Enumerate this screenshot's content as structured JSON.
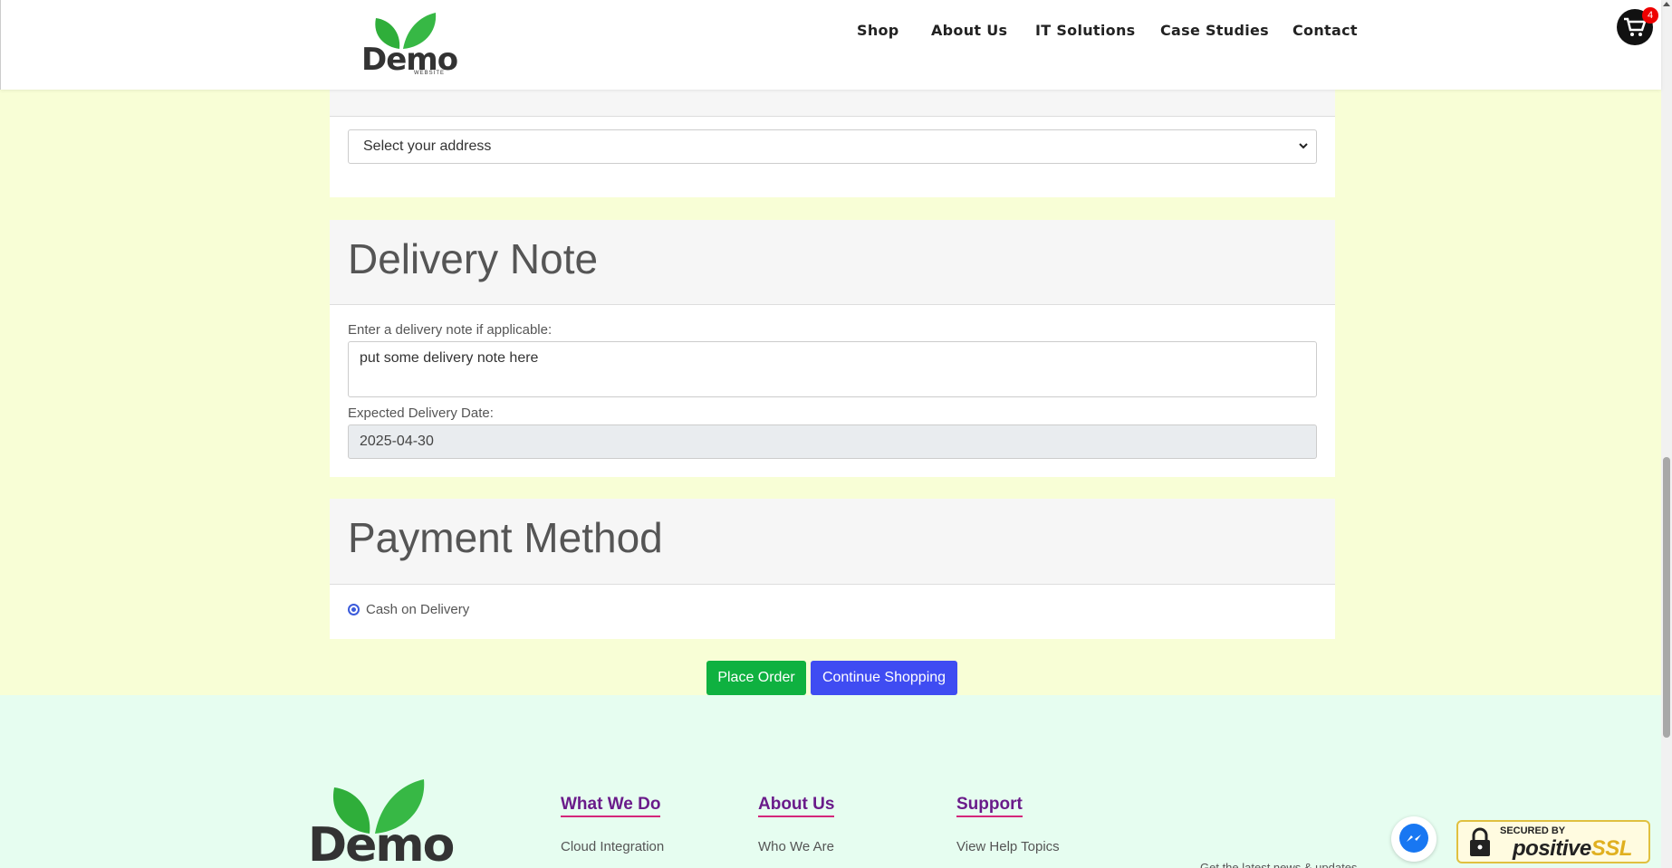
{
  "header": {
    "logo_text": "Demo",
    "logo_sub": "WEBSITE",
    "nav": [
      "Shop",
      "About Us",
      "IT Solutions",
      "Case Studies",
      "Contact"
    ],
    "cart_count": "4"
  },
  "address": {
    "select_value": "Select your address"
  },
  "delivery": {
    "title": "Delivery Note",
    "note_label": "Enter a delivery note if applicable:",
    "note_value": "put some delivery note here",
    "date_label": "Expected Delivery Date:",
    "date_value": "2025-04-30"
  },
  "payment": {
    "title": "Payment Method",
    "option_label": "Cash on Delivery",
    "option_selected": true
  },
  "actions": {
    "place_order": "Place Order",
    "continue_shopping": "Continue Shopping"
  },
  "footer": {
    "logo_text": "Demo",
    "columns": [
      {
        "heading": "What We Do",
        "link": "Cloud Integration"
      },
      {
        "heading": "About Us",
        "link": "Who We Are"
      },
      {
        "heading": "Support",
        "link": "View Help Topics"
      }
    ],
    "extra_text": "Get the latest news & updates"
  },
  "badges": {
    "ssl_line1": "SECURED BY",
    "ssl_line2_prefix": "positive",
    "ssl_line2_suffix": "SSL"
  },
  "colors": {
    "page_bg": "#f8fed6",
    "footer_bg": "#e6fdf0",
    "place_order": "#0fb140",
    "continue_shopping": "#3f4cf2",
    "footer_heading": "#6a1b8a",
    "cart_badge": "#e00000"
  },
  "icons": [
    "leaf-logo-icon",
    "cart-icon",
    "chevron-down-icon",
    "messenger-icon",
    "lock-icon"
  ]
}
